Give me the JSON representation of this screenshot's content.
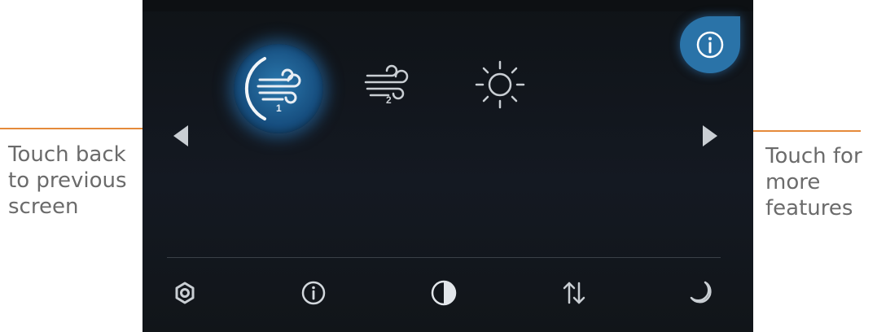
{
  "annotations": {
    "left_caption": "Touch back\nto previous\nscreen",
    "right_caption": "Touch for\nmore\nfeatures",
    "line_color": "#e58a3a",
    "caption_color": "#6b6b6b"
  },
  "screen": {
    "modes": [
      {
        "icon": "wind-icon",
        "level": "1",
        "active": true
      },
      {
        "icon": "wind-icon",
        "level": "2",
        "active": false
      },
      {
        "icon": "sun-icon",
        "level": "",
        "active": false
      }
    ],
    "nav": {
      "prev_icon": "triangle-left-icon",
      "next_icon": "triangle-right-icon"
    },
    "info_button_icon": "info-icon",
    "bottom_bar": [
      {
        "icon": "gear-icon"
      },
      {
        "icon": "info-icon"
      },
      {
        "icon": "contrast-icon"
      },
      {
        "icon": "swap-vertical-icon"
      },
      {
        "icon": "moon-icon"
      }
    ],
    "accent_color": "#2a73a8"
  }
}
